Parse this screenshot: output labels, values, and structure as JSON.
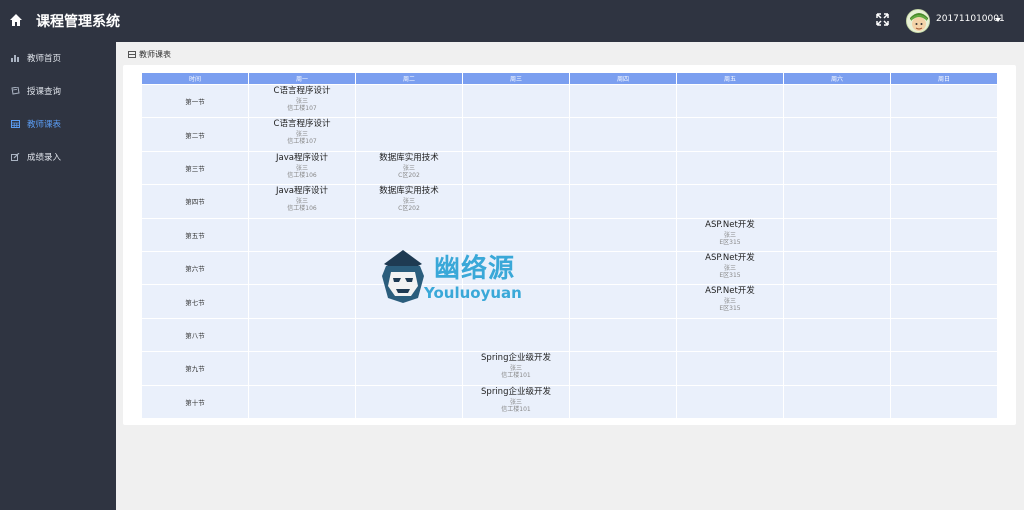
{
  "header": {
    "app_title": "课程管理系统",
    "username": "201711010001",
    "home_icon": "home-icon",
    "expand_icon": "fullscreen-icon",
    "caret_icon": "caret-down-icon"
  },
  "sidebar": {
    "items": [
      {
        "label": "教师首页",
        "icon": "bar-chart-icon",
        "active": false
      },
      {
        "label": "授课查询",
        "icon": "book-icon",
        "active": false
      },
      {
        "label": "教师课表",
        "icon": "table-icon",
        "active": true
      },
      {
        "label": "成绩录入",
        "icon": "edit-icon",
        "active": false
      }
    ]
  },
  "breadcrumb": {
    "label": "教师课表",
    "icon": "table-icon"
  },
  "schedule": {
    "headers": [
      "时间",
      "周一",
      "周二",
      "周三",
      "周四",
      "周五",
      "周六",
      "周日"
    ],
    "rows": [
      {
        "period": "第一节",
        "cells": [
          {
            "name": "C语言程序设计",
            "teacher": "张三",
            "room": "信工楼107"
          },
          null,
          null,
          null,
          null,
          null,
          null
        ]
      },
      {
        "period": "第二节",
        "cells": [
          {
            "name": "C语言程序设计",
            "teacher": "张三",
            "room": "信工楼107"
          },
          null,
          null,
          null,
          null,
          null,
          null
        ]
      },
      {
        "period": "第三节",
        "cells": [
          {
            "name": "Java程序设计",
            "teacher": "张三",
            "room": "信工楼106"
          },
          {
            "name": "数据库实用技术",
            "teacher": "张三",
            "room": "C区202"
          },
          null,
          null,
          null,
          null,
          null
        ]
      },
      {
        "period": "第四节",
        "cells": [
          {
            "name": "Java程序设计",
            "teacher": "张三",
            "room": "信工楼106"
          },
          {
            "name": "数据库实用技术",
            "teacher": "张三",
            "room": "C区202"
          },
          null,
          null,
          null,
          null,
          null
        ]
      },
      {
        "period": "第五节",
        "cells": [
          null,
          null,
          null,
          null,
          {
            "name": "ASP.Net开发",
            "teacher": "张三",
            "room": "E区315"
          },
          null,
          null
        ]
      },
      {
        "period": "第六节",
        "cells": [
          null,
          null,
          null,
          null,
          {
            "name": "ASP.Net开发",
            "teacher": "张三",
            "room": "E区315"
          },
          null,
          null
        ]
      },
      {
        "period": "第七节",
        "cells": [
          null,
          null,
          null,
          null,
          {
            "name": "ASP.Net开发",
            "teacher": "张三",
            "room": "E区315"
          },
          null,
          null
        ]
      },
      {
        "period": "第八节",
        "cells": [
          null,
          null,
          null,
          null,
          null,
          null,
          null
        ]
      },
      {
        "period": "第九节",
        "cells": [
          null,
          null,
          {
            "name": "Spring企业级开发",
            "teacher": "张三",
            "room": "信工楼101"
          },
          null,
          null,
          null,
          null
        ]
      },
      {
        "period": "第十节",
        "cells": [
          null,
          null,
          {
            "name": "Spring企业级开发",
            "teacher": "张三",
            "room": "信工楼101"
          },
          null,
          null,
          null,
          null
        ]
      }
    ]
  },
  "watermark": {
    "text": "幽络源",
    "subtext": "Youluoyuan"
  },
  "colors": {
    "topbar": "#2f3441",
    "sidebar": "#2f3441",
    "table_header": "#7b9ff0",
    "cell_bg": "#eaf0fb",
    "active_nav": "#5b9cf2",
    "watermark": "#3aa8d8"
  }
}
